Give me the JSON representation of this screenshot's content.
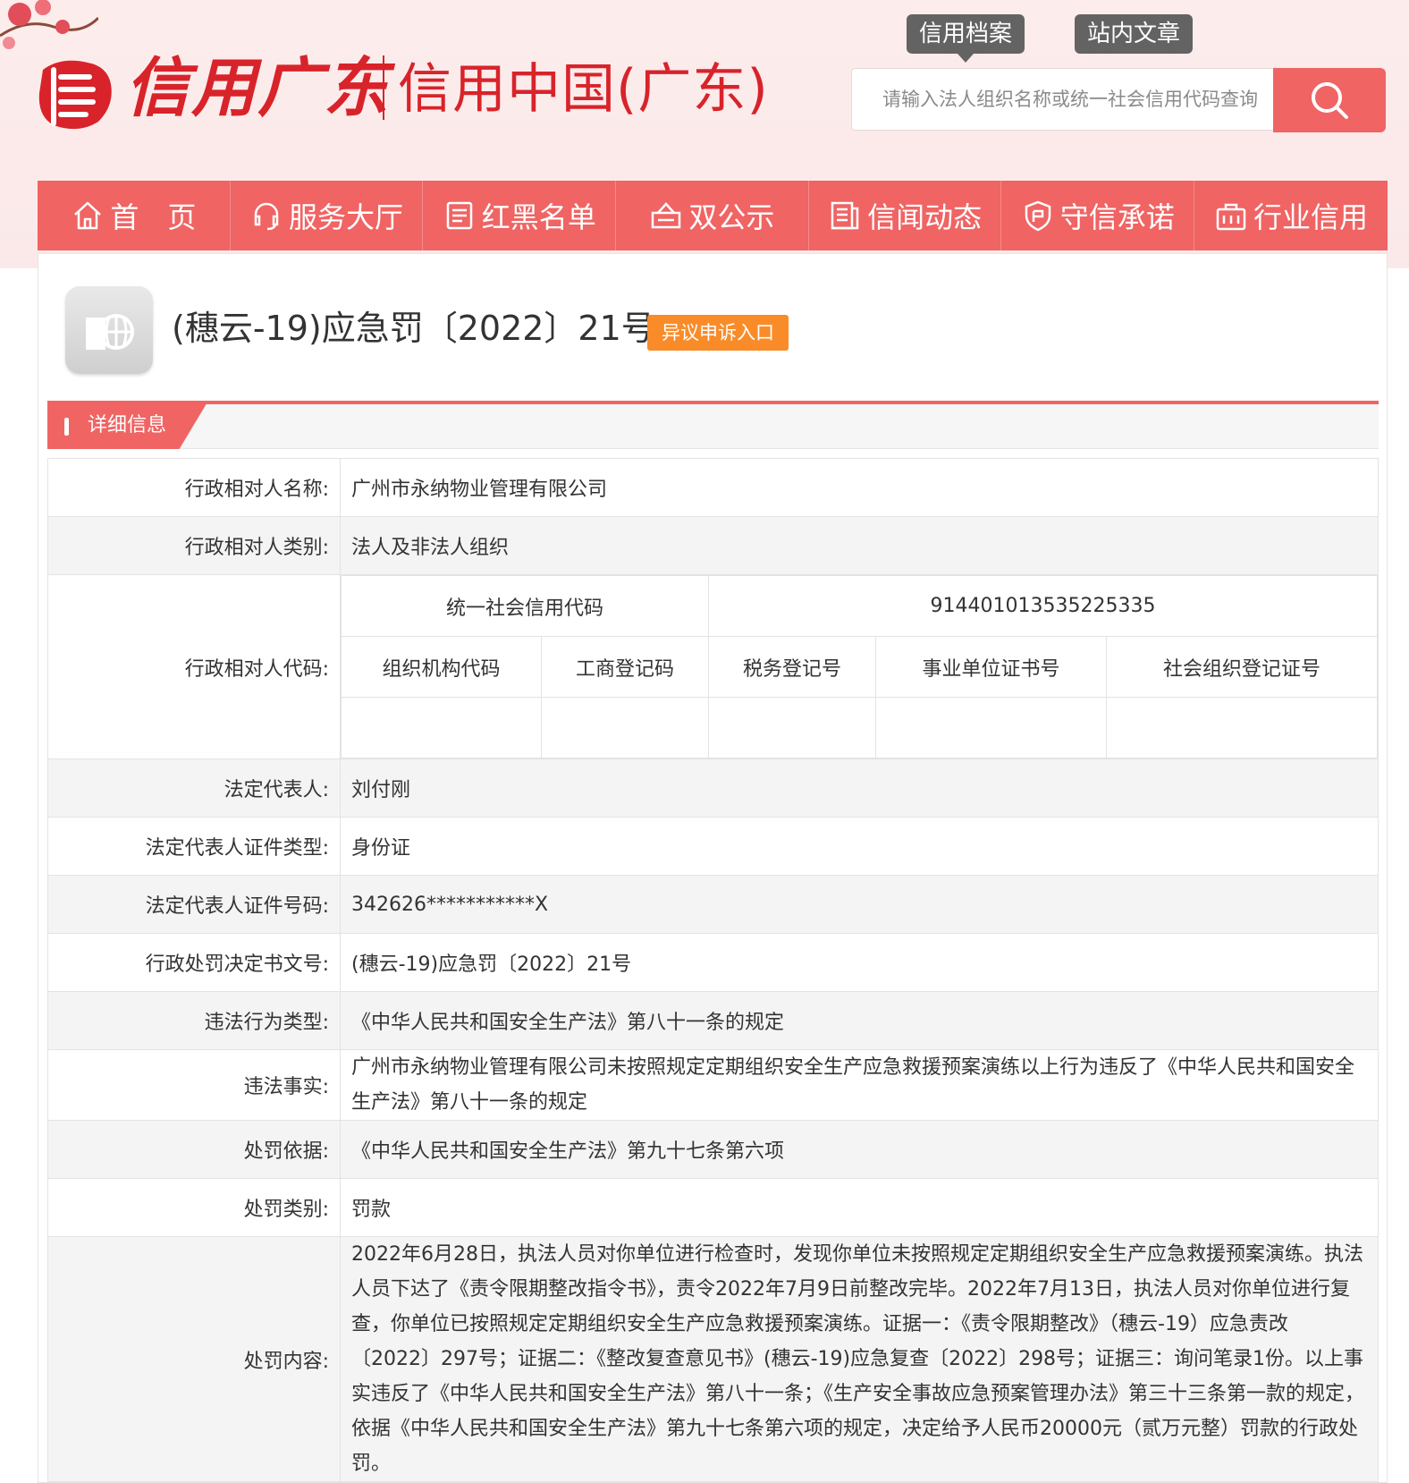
{
  "header": {
    "logo_brush_text": "信用广东",
    "logo_main_text": "信用中国(广东)",
    "tabs": [
      "信用档案",
      "站内文章"
    ],
    "search_placeholder": "请输入法人组织名称或统一社会信用代码查询"
  },
  "nav": [
    {
      "label": "首　页",
      "icon": "home-icon"
    },
    {
      "label": "服务大厅",
      "icon": "headset-icon"
    },
    {
      "label": "红黑名单",
      "icon": "list-icon"
    },
    {
      "label": "双公示",
      "icon": "announce-icon"
    },
    {
      "label": "信闻动态",
      "icon": "news-icon"
    },
    {
      "label": "守信承诺",
      "icon": "shield-icon"
    },
    {
      "label": "行业信用",
      "icon": "industry-icon"
    }
  ],
  "doc": {
    "title": "(穗云-19)应急罚〔2022〕21号",
    "appeal_label": "异议申诉入口"
  },
  "section": {
    "label": "详细信息"
  },
  "detail": {
    "subject_name_label": "行政相对人名称:",
    "subject_name": "广州市永纳物业管理有限公司",
    "subject_type_label": "行政相对人类别:",
    "subject_type": "法人及非法人组织",
    "subject_code_label": "行政相对人代码:",
    "usc_label": "统一社会信用代码",
    "usc_value": "914401013535225335",
    "code_headers": [
      "组织机构代码",
      "工商登记码",
      "税务登记号",
      "事业单位证书号",
      "社会组织登记证号"
    ],
    "legal_rep_label": "法定代表人:",
    "legal_rep": "刘付刚",
    "id_type_label": "法定代表人证件类型:",
    "id_type": "身份证",
    "id_number_label": "法定代表人证件号码:",
    "id_number": "342626***********X",
    "decision_no_label": "行政处罚决定书文号:",
    "decision_no": "(穗云-19)应急罚〔2022〕21号",
    "violation_type_label": "违法行为类型:",
    "violation_type": "《中华人民共和国安全生产法》第八十一条的规定",
    "violation_fact_label": "违法事实:",
    "violation_fact": "广州市永纳物业管理有限公司未按照规定定期组织安全生产应急救援预案演练以上行为违反了《中华人民共和国安全生产法》第八十一条的规定",
    "penalty_basis_label": "处罚依据:",
    "penalty_basis": "《中华人民共和国安全生产法》第九十七条第六项",
    "penalty_type_label": "处罚类别:",
    "penalty_type": "罚款",
    "penalty_content_label": "处罚内容:",
    "penalty_content": "2022年6月28日，执法人员对你单位进行检查时，发现你单位未按照规定定期组织安全生产应急救援预案演练。执法人员下达了《责令限期整改指令书》，责令2022年7月9日前整改完毕。2022年7月13日，执法人员对你单位进行复查，你单位已按照规定定期组织安全生产应急救援预案演练。证据一：《责令限期整改》（穗云-19）应急责改〔2022〕297号；证据二：《整改复查意见书》(穗云-19)应急复查〔2022〕298号；证据三：询问笔录1份。以上事实违反了《中华人民共和国安全生产法》第八十一条；《生产安全事故应急预案管理办法》第三十三条第一款的规定，依据《中华人民共和国安全生产法》第九十七条第六项的规定，决定给予人民币20000元（贰万元整）罚款的行政处罚。"
  },
  "colors": {
    "brand_red": "#f06464",
    "logo_red": "#d8232a",
    "appeal_orange": "#f98c29",
    "tab_gray": "#636363"
  }
}
